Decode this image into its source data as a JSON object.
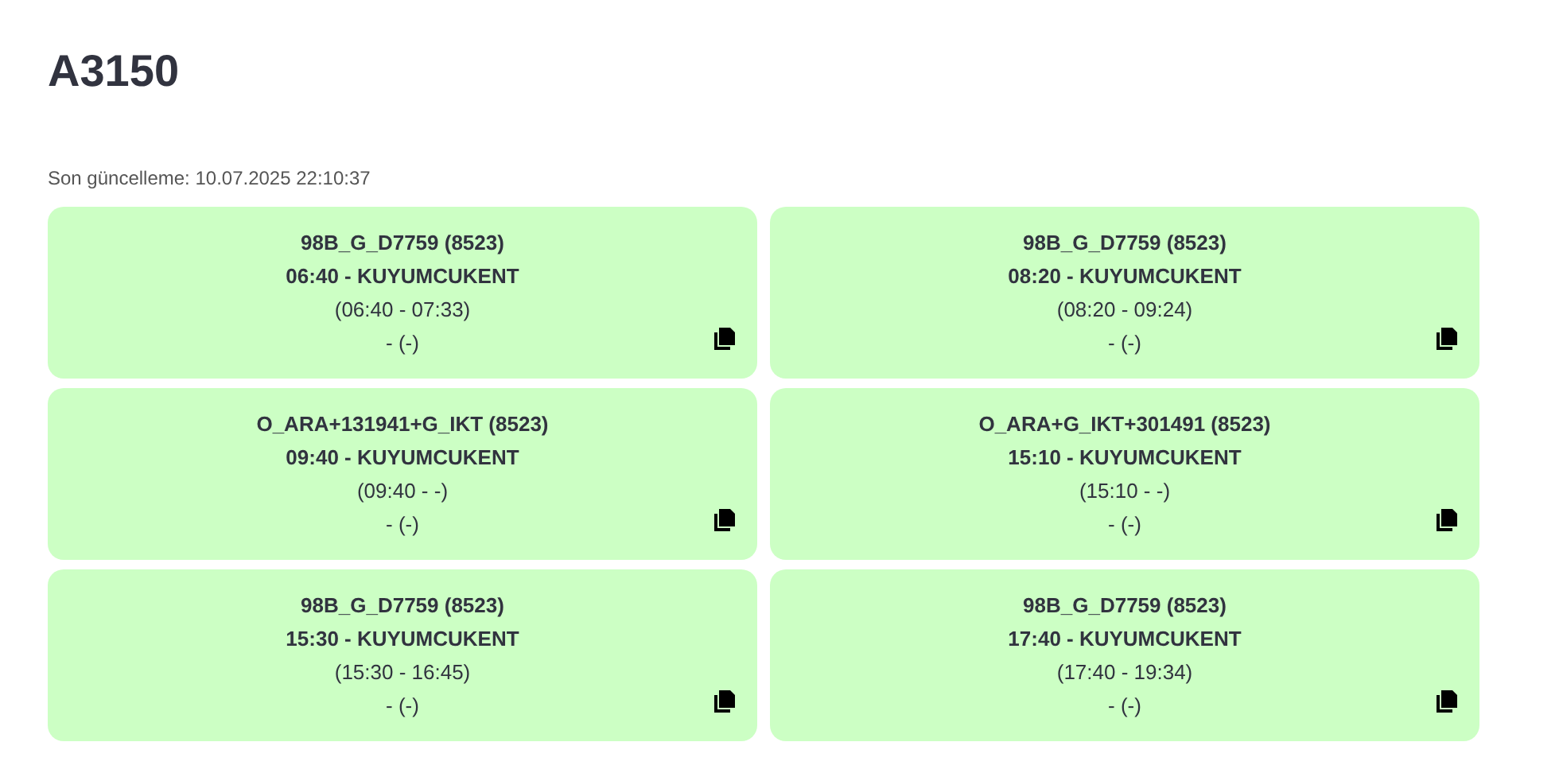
{
  "title": "A3150",
  "last_update": "Son güncelleme: 10.07.2025 22:10:37",
  "cards": [
    {
      "route": "98B_G_D7759 (8523)",
      "departure": "06:40 - KUYUMCUKENT",
      "times": "(06:40 - 07:33)",
      "extra": "- (-)"
    },
    {
      "route": "98B_G_D7759 (8523)",
      "departure": "08:20 - KUYUMCUKENT",
      "times": "(08:20 - 09:24)",
      "extra": "- (-)"
    },
    {
      "route": "O_ARA+131941+G_IKT (8523)",
      "departure": "09:40 - KUYUMCUKENT",
      "times": "(09:40 - -)",
      "extra": "- (-)"
    },
    {
      "route": "O_ARA+G_IKT+301491 (8523)",
      "departure": "15:10 - KUYUMCUKENT",
      "times": "(15:10 - -)",
      "extra": "- (-)"
    },
    {
      "route": "98B_G_D7759 (8523)",
      "departure": "15:30 - KUYUMCUKENT",
      "times": "(15:30 - 16:45)",
      "extra": "- (-)"
    },
    {
      "route": "98B_G_D7759 (8523)",
      "departure": "17:40 - KUYUMCUKENT",
      "times": "(17:40 - 19:34)",
      "extra": "- (-)"
    }
  ]
}
